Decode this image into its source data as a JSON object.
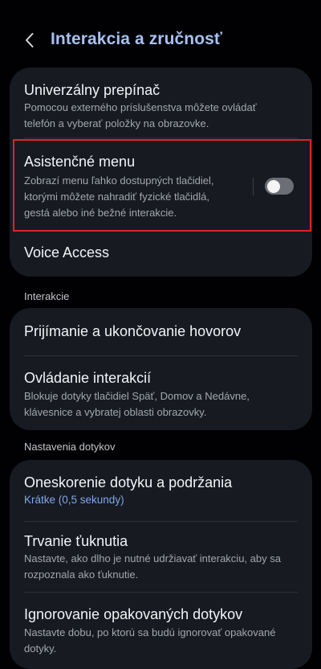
{
  "header": {
    "title": "Interakcia a zručnosť"
  },
  "card1": {
    "universal_switch": {
      "title": "Univerzálny prepínač",
      "subtitle_line1": "Pomocou externého príslušenstva môžete ovládať",
      "subtitle_line2": "telefón a vyberať položky na obrazovke."
    },
    "assistant_menu": {
      "title": "Asistenčné menu",
      "subtitle_line1": "Zobrazí menu ľahko dostupných tlačidiel,",
      "subtitle_line2": "ktorými môžete nahradiť fyzické tlačidlá,",
      "subtitle_line3": "gestá alebo iné bežné interakcie.",
      "enabled": false
    },
    "voice_access": {
      "title": "Voice Access"
    }
  },
  "section_interaction": {
    "label": "Interakcie"
  },
  "card2": {
    "calls": {
      "title": "Prijímanie a ukončovanie hovorov"
    },
    "interaction_control": {
      "title": "Ovládanie interakcií",
      "subtitle_line1": "Blokuje dotyky tlačidiel Späť, Domov a Nedávne,",
      "subtitle_line2": "klávesnice a vybratej oblasti obrazovky."
    }
  },
  "section_touch": {
    "label": "Nastavenia dotykov"
  },
  "card3": {
    "touch_delay": {
      "title": "Oneskorenie dotyku a podržania",
      "value": "Krátke (0,5 sekundy)"
    },
    "tap_duration": {
      "title": "Trvanie ťuknutia",
      "subtitle_line1": "Nastavte, ako dlho je nutné udržiavať interakciu, aby sa",
      "subtitle_line2": "rozpoznala ako ťuknutie."
    },
    "ignore_repeated": {
      "title": "Ignorovanie opakovaných dotykov",
      "subtitle_line1": "Nastavte dobu, po ktorú sa budú ignorovať opakované",
      "subtitle_line2": "dotyky."
    }
  },
  "colors": {
    "background": "#010103",
    "card": "#171a21",
    "title_accent": "#a7c1f4",
    "value_accent": "#7fa7ec",
    "highlight": "#e3222a"
  }
}
